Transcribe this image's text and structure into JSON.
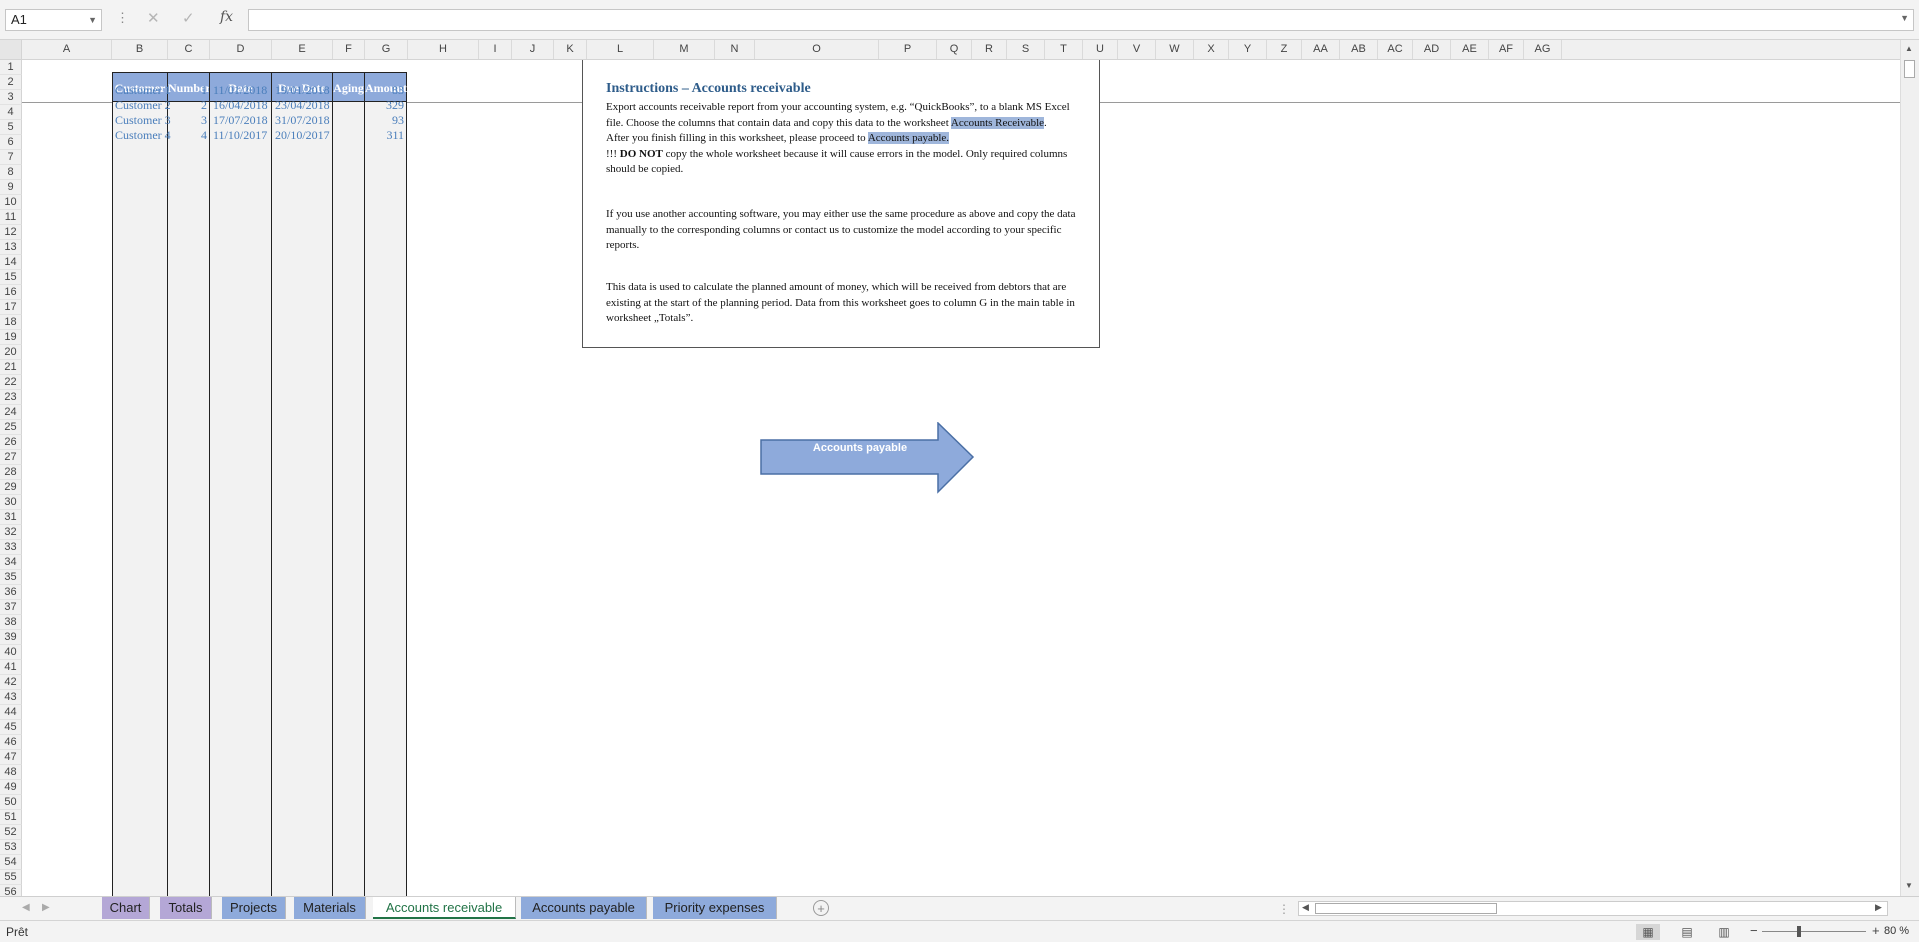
{
  "formula_bar": {
    "name_box": "A1",
    "fx_label": "fx",
    "formula": ""
  },
  "columns": [
    "A",
    "B",
    "C",
    "D",
    "E",
    "F",
    "G",
    "H",
    "I",
    "J",
    "K",
    "L",
    "M",
    "N",
    "O",
    "P",
    "Q",
    "R",
    "S",
    "T",
    "U",
    "V",
    "W",
    "X",
    "Y",
    "Z",
    "AA",
    "AB",
    "AC",
    "AD",
    "AE",
    "AF",
    "AG"
  ],
  "rows": [
    "1",
    "2",
    "3",
    "4",
    "5",
    "6",
    "7",
    "8",
    "9",
    "10",
    "11",
    "12",
    "13",
    "14",
    "15",
    "16",
    "17",
    "18",
    "19",
    "20",
    "21",
    "22",
    "23",
    "24",
    "25",
    "26",
    "27",
    "28",
    "29",
    "30",
    "31",
    "32",
    "33",
    "34",
    "35",
    "36",
    "37",
    "38",
    "39",
    "40",
    "41",
    "42",
    "43",
    "44",
    "45",
    "46",
    "47",
    "48",
    "49",
    "50",
    "51",
    "52",
    "53",
    "54",
    "55",
    "56"
  ],
  "table": {
    "headers": {
      "customer": "Customer",
      "number": "Number",
      "date": "Date",
      "due_date": "Due Date",
      "aging": "Aging",
      "amount": "Amount"
    },
    "rows": [
      {
        "customer": "Customer 1",
        "number": "1",
        "date": "11/01/2018",
        "due_date": "19/01/2018",
        "aging": "",
        "amount": "83"
      },
      {
        "customer": "Customer 2",
        "number": "2",
        "date": "16/04/2018",
        "due_date": "23/04/2018",
        "aging": "",
        "amount": "329"
      },
      {
        "customer": "Customer 3",
        "number": "3",
        "date": "17/07/2018",
        "due_date": "31/07/2018",
        "aging": "",
        "amount": "93"
      },
      {
        "customer": "Customer 4",
        "number": "4",
        "date": "11/10/2017",
        "due_date": "20/10/2017",
        "aging": "",
        "amount": "311"
      }
    ]
  },
  "instructions": {
    "title": "Instructions – Accounts receivable",
    "p1_a": "Export accounts receivable report from your accounting system, e.g. “QuickBooks”, to a blank MS Excel file. Choose the columns that contain data and copy this data to the worksheet ",
    "p1_link": "Accounts Receivable",
    "p1_end": ".",
    "p2_a": "After you finish filling in this worksheet, please proceed to ",
    "p2_link": "Accounts payable.",
    "p3_a": "!!! ",
    "p3_bold": "DO NOT",
    "p3_b": " copy the whole worksheet because it will cause errors in the model. Only required columns should be copied.",
    "p4": "If you use another accounting software, you may either use the same procedure as above and copy the data manually to the corresponding columns or contact us to customize the model according to your specific reports.",
    "p5": "This data is used to calculate the planned amount of money, which will be received from debtors that are existing at the start of the planning period. Data from this worksheet goes to column G in the main table in worksheet „Totals”."
  },
  "arrow_button": {
    "label": "Accounts payable",
    "fill": "#8eaadb",
    "stroke": "#4a6fa5"
  },
  "sheet_tabs": [
    {
      "label": "Chart",
      "color": "#b4a7d6",
      "active": false
    },
    {
      "label": "Totals",
      "color": "#b4a7d6",
      "active": false
    },
    {
      "label": "Projects",
      "color": "#8eaadb",
      "active": false
    },
    {
      "label": "Materials",
      "color": "#8eaadb",
      "active": false
    },
    {
      "label": "Accounts receivable",
      "color": "#ffffff",
      "active": true
    },
    {
      "label": "Accounts payable",
      "color": "#8eaadb",
      "active": false
    },
    {
      "label": "Priority expenses",
      "color": "#8eaadb",
      "active": false
    }
  ],
  "status_bar": {
    "status": "Prêt",
    "zoom": "80 %"
  }
}
